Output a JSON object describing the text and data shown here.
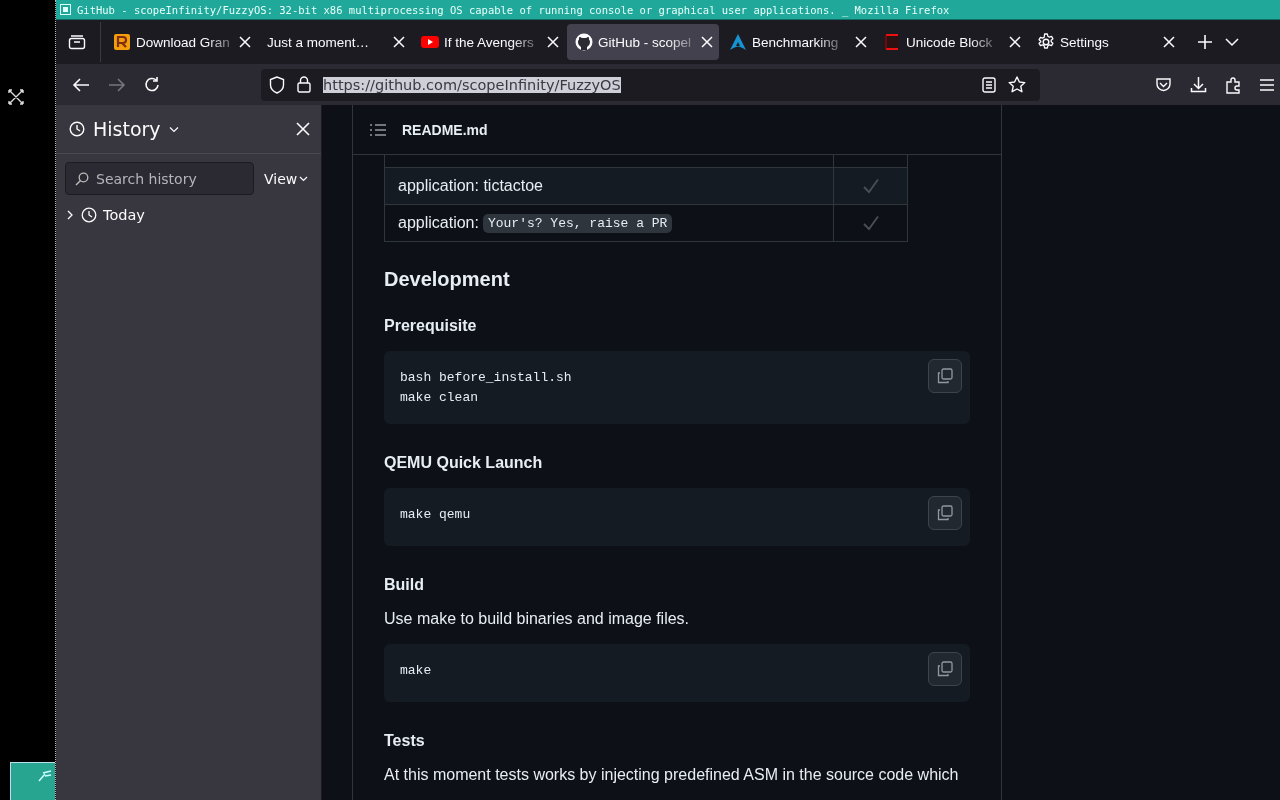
{
  "window": {
    "title": "GitHub - scopeInfinity/FuzzyOS: 32-bit x86 multiprocessing OS capable of running console or graphical user applications. _ Mozilla Firefox"
  },
  "tabs": [
    {
      "label": "Download Gran",
      "kind": "letter",
      "faded": true,
      "selected": false
    },
    {
      "label": "Just a moment…",
      "kind": "plain",
      "faded": false,
      "selected": false
    },
    {
      "label": "If the Avengers",
      "kind": "video",
      "faded": true,
      "selected": false
    },
    {
      "label": "GitHub - scopel",
      "kind": "cat",
      "faded": true,
      "selected": true
    },
    {
      "label": "Benchmarking",
      "kind": "triangle",
      "faded": true,
      "selected": false
    },
    {
      "label": "Unicode Block",
      "kind": "bracket",
      "faded": true,
      "selected": false
    },
    {
      "label": "Settings",
      "kind": "gear",
      "faded": false,
      "selected": false
    }
  ],
  "toolbar": {
    "url": "https://github.com/scopeInfinity/FuzzyOS",
    "url_selected": true
  },
  "sidebar": {
    "title": "History",
    "search": {
      "placeholder": "Search history"
    },
    "view_button": "View",
    "items": [
      {
        "label": "Today",
        "expanded": false
      }
    ]
  },
  "readme": {
    "filename": "README.md",
    "table_rows": [
      {
        "text": "application: tictactoe",
        "checked": true
      },
      {
        "text": "application: ",
        "code": "Your's? Yes, raise a PR",
        "checked": true
      }
    ],
    "blocks": [
      {
        "kind": "h2",
        "text": "Development"
      },
      {
        "kind": "h3",
        "text": "Prerequisite"
      },
      {
        "kind": "code",
        "lines": [
          "bash before_install.sh",
          "make clean"
        ]
      },
      {
        "kind": "h3",
        "text": "QEMU Quick Launch"
      },
      {
        "kind": "code",
        "lines": [
          "make qemu"
        ]
      },
      {
        "kind": "h3",
        "text": "Build"
      },
      {
        "kind": "p",
        "text": "Use make to build binaries and image files."
      },
      {
        "kind": "code",
        "lines": [
          "make"
        ]
      },
      {
        "kind": "h3",
        "text": "Tests"
      },
      {
        "kind": "p",
        "text": "At this moment tests works by injecting predefined ASM in the source code which"
      }
    ]
  }
}
